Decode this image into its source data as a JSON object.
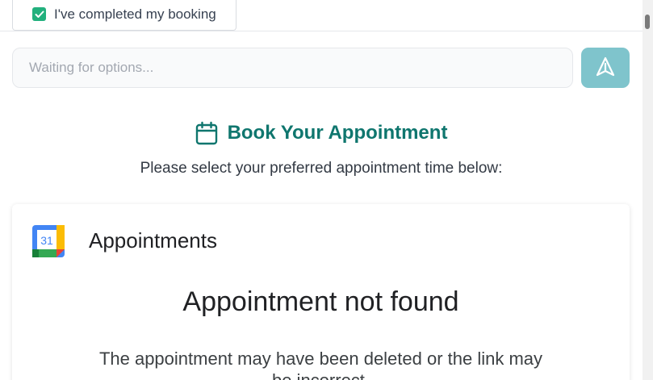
{
  "top_bar": {
    "booking_checkbox_label": "I've completed my booking",
    "booking_checked": true
  },
  "message_input": {
    "placeholder": "Waiting for options...",
    "value": ""
  },
  "send_button": {
    "icon": "send-icon"
  },
  "booking_header": {
    "icon": "calendar-icon",
    "title": "Book Your Appointment",
    "subtitle": "Please select your preferred appointment time below:"
  },
  "appointments_card": {
    "logo_text": "31",
    "title": "Appointments",
    "error_title": "Appointment not found",
    "error_description": "The appointment may have been deleted or the link may be incorrect."
  },
  "colors": {
    "accent_teal": "#0f766e",
    "send_button_bg": "#7fc4cc",
    "checkbox_green": "#22b07d"
  }
}
